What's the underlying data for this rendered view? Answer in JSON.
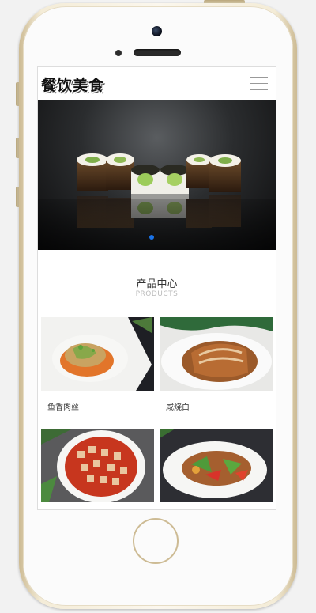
{
  "site": {
    "logo": "餐饮美食"
  },
  "banner": {
    "alt": "sushi rolls",
    "slides": 1,
    "active_slide": 1
  },
  "products_section": {
    "title": "产品中心",
    "subtitle": "PRODUCTS"
  },
  "products": [
    {
      "name": "鱼香肉丝"
    },
    {
      "name": "咸烧白"
    },
    {
      "name": ""
    },
    {
      "name": ""
    }
  ],
  "colors": {
    "accent": "#1a73e8",
    "phone_frame": "#e8dcbd"
  }
}
